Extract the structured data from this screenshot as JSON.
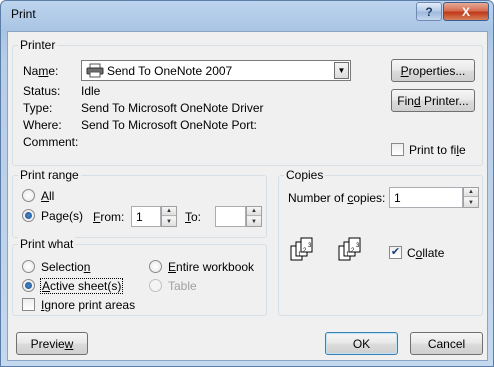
{
  "window": {
    "title": "Print",
    "help_glyph": "?",
    "close_glyph": "X"
  },
  "printer": {
    "group_label": "Printer",
    "name_label": "Name:",
    "name_value": "Send To OneNote 2007",
    "status_label": "Status:",
    "status_value": "Idle",
    "type_label": "Type:",
    "type_value": "Send To Microsoft OneNote Driver",
    "where_label": "Where:",
    "where_value": "Send To Microsoft OneNote Port:",
    "comment_label": "Comment:",
    "properties_label": "Properties...",
    "find_printer_label": "Find Printer...",
    "print_to_file_label": "Print to file",
    "print_to_file_checked": false
  },
  "print_range": {
    "group_label": "Print range",
    "all_label": "All",
    "pages_label": "Page(s)",
    "from_label": "From:",
    "from_value": "1",
    "to_label": "To:",
    "to_value": "",
    "selected": "pages"
  },
  "copies": {
    "group_label": "Copies",
    "number_label": "Number of copies:",
    "number_value": "1",
    "collate_label": "Collate",
    "collate_checked": true
  },
  "print_what": {
    "group_label": "Print what",
    "selection_label": "Selection",
    "entire_workbook_label": "Entire workbook",
    "active_sheets_label": "Active sheet(s)",
    "table_label": "Table",
    "ignore_print_areas_label": "Ignore print areas",
    "selected": "active_sheets"
  },
  "footer": {
    "preview_label": "Preview",
    "ok_label": "OK",
    "cancel_label": "Cancel"
  },
  "colors": {
    "accent": "#3c7fb1",
    "title_bar": "#a9c4e3",
    "close": "#c0391a"
  }
}
